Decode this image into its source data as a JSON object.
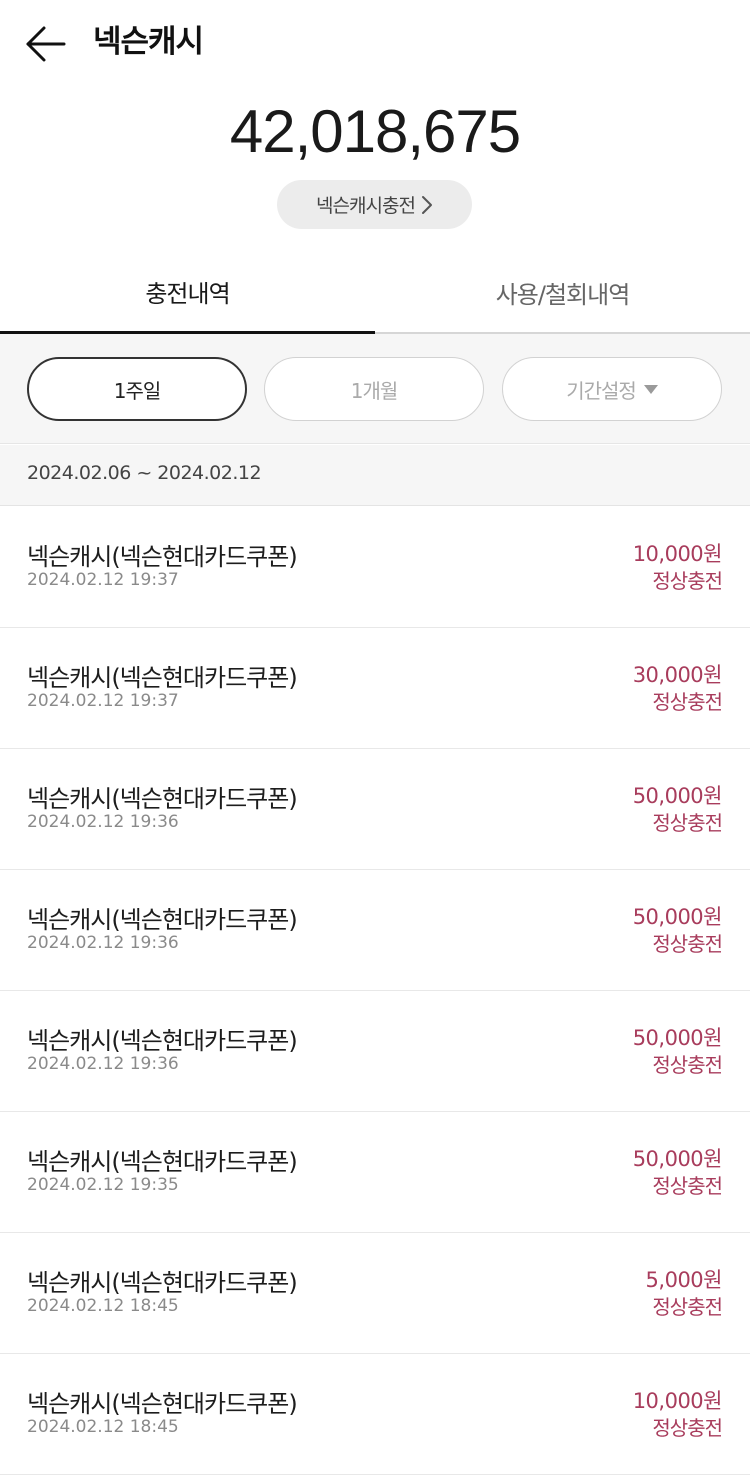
{
  "header": {
    "title": "넥슨캐시",
    "back_icon": "arrow-left-icon"
  },
  "balance": "42,018,675",
  "charge_button": {
    "label": "넥슨캐시충전",
    "icon": "chevron-right-icon"
  },
  "tabs": [
    {
      "label": "충전내역",
      "active": true
    },
    {
      "label": "사용/철회내역",
      "active": false
    }
  ],
  "filters": [
    {
      "label": "1주일",
      "active": true
    },
    {
      "label": "1개월",
      "active": false
    },
    {
      "label": "기간설정",
      "active": false,
      "icon": "caret-down-icon"
    }
  ],
  "date_range": "2024.02.06 ~ 2024.02.12",
  "colors": {
    "accent": "#a83c5c",
    "tab_active": "#111111"
  },
  "transactions": [
    {
      "title": "넥슨캐시(넥슨현대카드쿠폰)",
      "datetime": "2024.02.12 19:37",
      "amount": "10,000원",
      "status": "정상충전"
    },
    {
      "title": "넥슨캐시(넥슨현대카드쿠폰)",
      "datetime": "2024.02.12 19:37",
      "amount": "30,000원",
      "status": "정상충전"
    },
    {
      "title": "넥슨캐시(넥슨현대카드쿠폰)",
      "datetime": "2024.02.12 19:36",
      "amount": "50,000원",
      "status": "정상충전"
    },
    {
      "title": "넥슨캐시(넥슨현대카드쿠폰)",
      "datetime": "2024.02.12 19:36",
      "amount": "50,000원",
      "status": "정상충전"
    },
    {
      "title": "넥슨캐시(넥슨현대카드쿠폰)",
      "datetime": "2024.02.12 19:36",
      "amount": "50,000원",
      "status": "정상충전"
    },
    {
      "title": "넥슨캐시(넥슨현대카드쿠폰)",
      "datetime": "2024.02.12 19:35",
      "amount": "50,000원",
      "status": "정상충전"
    },
    {
      "title": "넥슨캐시(넥슨현대카드쿠폰)",
      "datetime": "2024.02.12 18:45",
      "amount": "5,000원",
      "status": "정상충전"
    },
    {
      "title": "넥슨캐시(넥슨현대카드쿠폰)",
      "datetime": "2024.02.12 18:45",
      "amount": "10,000원",
      "status": "정상충전"
    }
  ]
}
